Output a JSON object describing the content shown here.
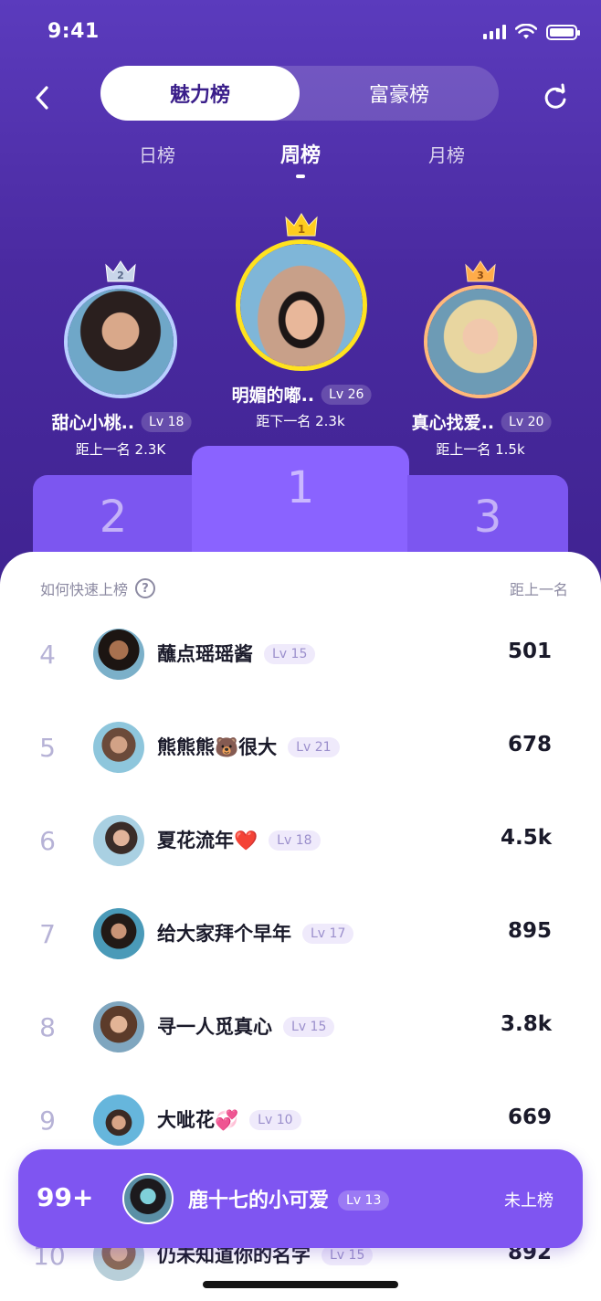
{
  "status_bar": {
    "time": "9:41"
  },
  "header": {
    "segments": [
      {
        "label": "魅力榜",
        "active": true
      },
      {
        "label": "富豪榜",
        "active": false
      }
    ],
    "periods": [
      {
        "label": "日榜",
        "active": false
      },
      {
        "label": "周榜",
        "active": true
      },
      {
        "label": "月榜",
        "active": false
      }
    ]
  },
  "podium": {
    "first": {
      "rank": "1",
      "name": "明媚的嘟..",
      "level": "Lv 26",
      "gap": "距下一名 2.3k",
      "ring_color": "#ffe21f"
    },
    "second": {
      "rank": "2",
      "name": "甜心小桃..",
      "level": "Lv 18",
      "gap": "距上一名 2.3K",
      "ring_color": "#b9d0ff"
    },
    "third": {
      "rank": "3",
      "name": "真心找爱..",
      "level": "Lv 20",
      "gap": "距上一名 1.5k",
      "ring_color": "#ffb97a"
    }
  },
  "list": {
    "help_label": "如何快速上榜",
    "gap_header": "距上一名",
    "rows": [
      {
        "rank": "4",
        "name": "蘸点瑶瑶酱",
        "level": "Lv 15",
        "score": "501"
      },
      {
        "rank": "5",
        "name": "熊熊熊🐻很大",
        "level": "Lv 21",
        "score": "678"
      },
      {
        "rank": "6",
        "name": "夏花流年❤️",
        "level": "Lv 18",
        "score": "4.5k"
      },
      {
        "rank": "7",
        "name": "给大家拜个早年",
        "level": "Lv 17",
        "score": "895"
      },
      {
        "rank": "8",
        "name": "寻一人觅真心",
        "level": "Lv 15",
        "score": "3.8k"
      },
      {
        "rank": "9",
        "name": "大呲花💞",
        "level": "Lv 10",
        "score": "669"
      },
      {
        "rank": "10",
        "name": "仍未知道你的名字",
        "level": "Lv 15",
        "score": "892"
      }
    ]
  },
  "self": {
    "rank": "99+",
    "name": "鹿十七的小可爱",
    "level": "Lv 13",
    "status": "未上榜"
  },
  "colors": {
    "accent": "#7f55f1",
    "header_bg": "#4a2aa0"
  }
}
